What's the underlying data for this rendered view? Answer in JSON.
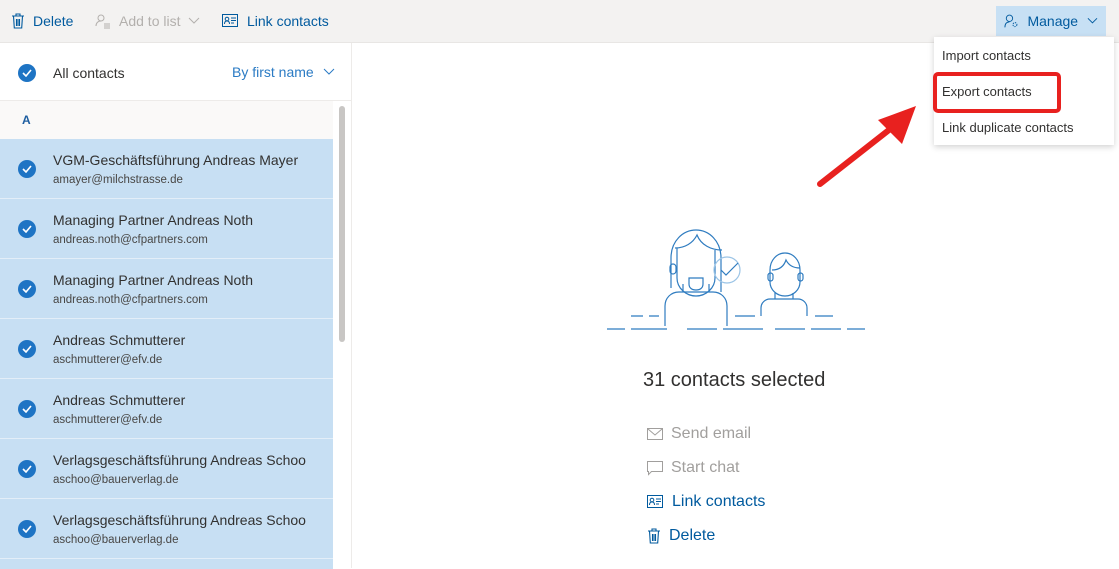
{
  "toolbar": {
    "delete_label": "Delete",
    "add_to_list_label": "Add to list",
    "link_contacts_label": "Link contacts",
    "manage_label": "Manage"
  },
  "manage_menu": {
    "items": [
      {
        "label": "Import contacts"
      },
      {
        "label": "Export contacts",
        "highlighted": true
      },
      {
        "label": "Link duplicate contacts"
      }
    ]
  },
  "list": {
    "header_label": "All contacts",
    "sort_label": "By first name",
    "group_letter": "A",
    "contacts": [
      {
        "name": "VGM-Geschäftsführung Andreas Mayer",
        "email": "amayer@milchstrasse.de",
        "selected": true
      },
      {
        "name": "Managing Partner Andreas Noth",
        "email": "andreas.noth@cfpartners.com",
        "selected": true
      },
      {
        "name": "Managing Partner Andreas Noth",
        "email": "andreas.noth@cfpartners.com",
        "selected": true
      },
      {
        "name": "Andreas Schmutterer",
        "email": "aschmutterer@efv.de",
        "selected": true
      },
      {
        "name": "Andreas Schmutterer",
        "email": "aschmutterer@efv.de",
        "selected": true
      },
      {
        "name": "Verlagsgeschäftsführung Andreas Schoo",
        "email": "aschoo@bauerverlag.de",
        "selected": true
      },
      {
        "name": "Verlagsgeschäftsführung Andreas Schoo",
        "email": "aschoo@bauerverlag.de",
        "selected": true
      }
    ]
  },
  "detail": {
    "selected_count_text": "31 contacts selected",
    "actions": [
      {
        "label": "Send email",
        "icon": "mail-icon",
        "enabled": false
      },
      {
        "label": "Start chat",
        "icon": "chat-icon",
        "enabled": false
      },
      {
        "label": "Link contacts",
        "icon": "link-contacts-icon",
        "enabled": true
      },
      {
        "label": "Delete",
        "icon": "trash-icon",
        "enabled": true
      }
    ]
  },
  "colors": {
    "accent": "#005a9e",
    "selected_row": "#c7dff3",
    "check": "#1e74c4",
    "annotation_red": "#e8211f"
  }
}
